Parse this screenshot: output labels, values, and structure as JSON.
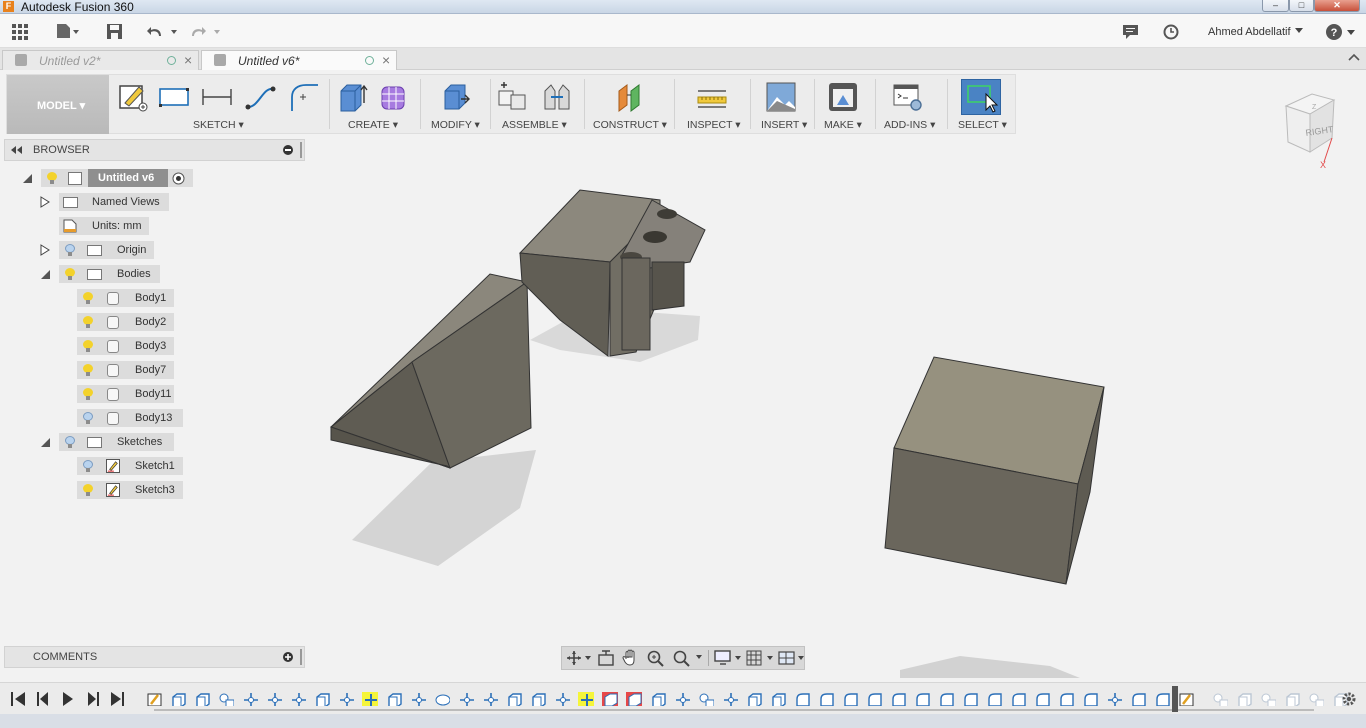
{
  "window": {
    "title": "Autodesk Fusion 360",
    "app_icon_letter": "F",
    "controls": [
      "–",
      "□",
      "✕"
    ]
  },
  "appbar": {
    "user_name": "Ahmed Abdellatif",
    "help_label": "?"
  },
  "tabs": [
    {
      "label": "Untitled v2*",
      "active": false
    },
    {
      "label": "Untitled v6*",
      "active": true
    }
  ],
  "toolbar": {
    "workspace": "MODEL ▾",
    "groups": [
      {
        "label": "SKETCH ▾"
      },
      {
        "label": "CREATE ▾"
      },
      {
        "label": "MODIFY ▾"
      },
      {
        "label": "ASSEMBLE ▾"
      },
      {
        "label": "CONSTRUCT ▾"
      },
      {
        "label": "INSPECT ▾"
      },
      {
        "label": "INSERT ▾"
      },
      {
        "label": "MAKE ▾"
      },
      {
        "label": "ADD-INS ▾"
      },
      {
        "label": "SELECT ▾"
      }
    ]
  },
  "viewcube": {
    "face_label": "RIGHT",
    "axis_z": "Z",
    "axis_x": "X"
  },
  "browser": {
    "title": "BROWSER",
    "root": "Untitled v6",
    "named_views": "Named Views",
    "units": "Units: mm",
    "origin": "Origin",
    "bodies_folder": "Bodies",
    "bodies": [
      "Body1",
      "Body2",
      "Body3",
      "Body7",
      "Body11",
      "Body13"
    ],
    "sketches_folder": "Sketches",
    "sketches": [
      "Sketch1",
      "Sketch3"
    ]
  },
  "comments": {
    "title": "COMMENTS"
  },
  "colors": {
    "accent": "#4a83c4",
    "bulb_on": "#f3d22b",
    "bulb_off": "#b9d3ee",
    "body_face": "#6e6a5e",
    "timeline_highlight": "#f5f53a",
    "timeline_error": "#e74848"
  }
}
